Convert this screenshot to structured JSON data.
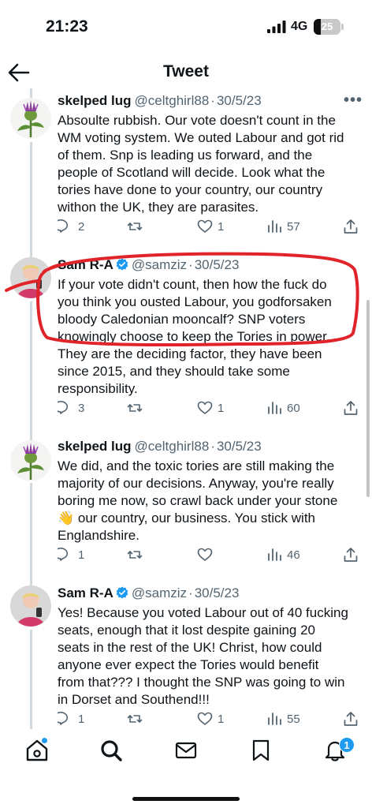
{
  "status": {
    "time": "21:23",
    "network": "4G",
    "battery": "25"
  },
  "header": {
    "title": "Tweet"
  },
  "tweets": [
    {
      "name": "skelped lug",
      "handle": "@celtghirl88",
      "date": "30/5/23",
      "verified": false,
      "text": "Absoulte rubbish. Our vote doesn't count in the WM voting system. We outed Labour and got rid of them. Snp is leading us forward, and the people of Scotland will decide. Look what the tories have done to your country, our country withon the UK, they are parasites.",
      "replies": "2",
      "retweets": "",
      "likes": "1",
      "views": "57"
    },
    {
      "name": "Sam R-A",
      "handle": "@samziz",
      "date": "30/5/23",
      "verified": true,
      "text": "If your vote didn't count, then how the fuck do you think you ousted Labour, you godforsaken bloody Caledonian mooncalf? SNP voters knowingly choose to keep the Tories in power. They are the deciding factor, they have been since 2015, and they should take some responsibility.",
      "replies": "3",
      "retweets": "",
      "likes": "1",
      "views": "60"
    },
    {
      "name": "skelped lug",
      "handle": "@celtghirl88",
      "date": "30/5/23",
      "verified": false,
      "text": "We did, and the toxic tories are still making the majority of our decisions. Anyway, you're really boring me now, so crawl back under your stone 👋 our country, our business. You stick with Englandshire.",
      "replies": "1",
      "retweets": "",
      "likes": "",
      "views": "46"
    },
    {
      "name": "Sam R-A",
      "handle": "@samziz",
      "date": "30/5/23",
      "verified": true,
      "text": "Yes! Because you voted Labour out of 40 fucking seats, enough that it lost despite gaining 20 seats in the rest of the UK! Christ, how could anyone ever expect the Tories would benefit from that??? I thought the SNP was going to win in Dorset and Southend!!!",
      "replies": "1",
      "retweets": "",
      "likes": "1",
      "views": "55"
    }
  ],
  "tabbar": {
    "notifications_count": "1"
  },
  "colors": {
    "accent": "#1d9bf0",
    "annotation": "#e0242a",
    "muted": "#536471"
  },
  "icons": [
    "back-arrow-icon",
    "more-icon",
    "reply-icon",
    "retweet-icon",
    "like-icon",
    "views-icon",
    "share-icon",
    "home-icon",
    "search-icon",
    "messages-icon",
    "bookmark-icon",
    "notifications-icon"
  ]
}
